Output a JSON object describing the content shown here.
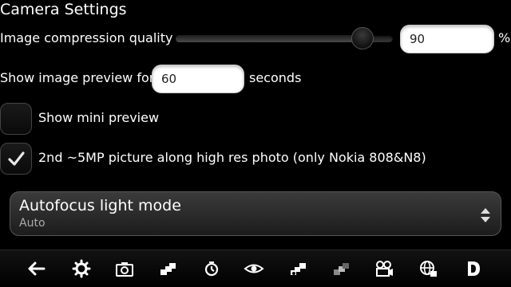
{
  "page_title": "Camera Settings",
  "compression": {
    "label": "Image compression quality",
    "value": "90",
    "unit": "%",
    "slider_fraction": 0.86
  },
  "preview": {
    "label": "Show image preview for",
    "value": "60",
    "unit": "seconds"
  },
  "mini_preview": {
    "label": "Show mini preview",
    "checked": false
  },
  "second_picture": {
    "label": "2nd ~5MP picture along high res photo (only Nokia 808&N8)",
    "checked": true
  },
  "autofocus": {
    "title": "Autofocus light mode",
    "value": "Auto"
  },
  "toolbar": {
    "icons": [
      "back-arrow-icon",
      "gear-icon",
      "camera-icon",
      "resolution-icon",
      "timer-icon",
      "eye-icon",
      "burst-icon",
      "focus-icon",
      "video-camera-icon",
      "globe-icon",
      "d-icon"
    ]
  },
  "colors": {
    "background": "#000000",
    "text": "#ffffff",
    "secondary_text": "#aaaaaa",
    "field_background": "#ffffff"
  }
}
